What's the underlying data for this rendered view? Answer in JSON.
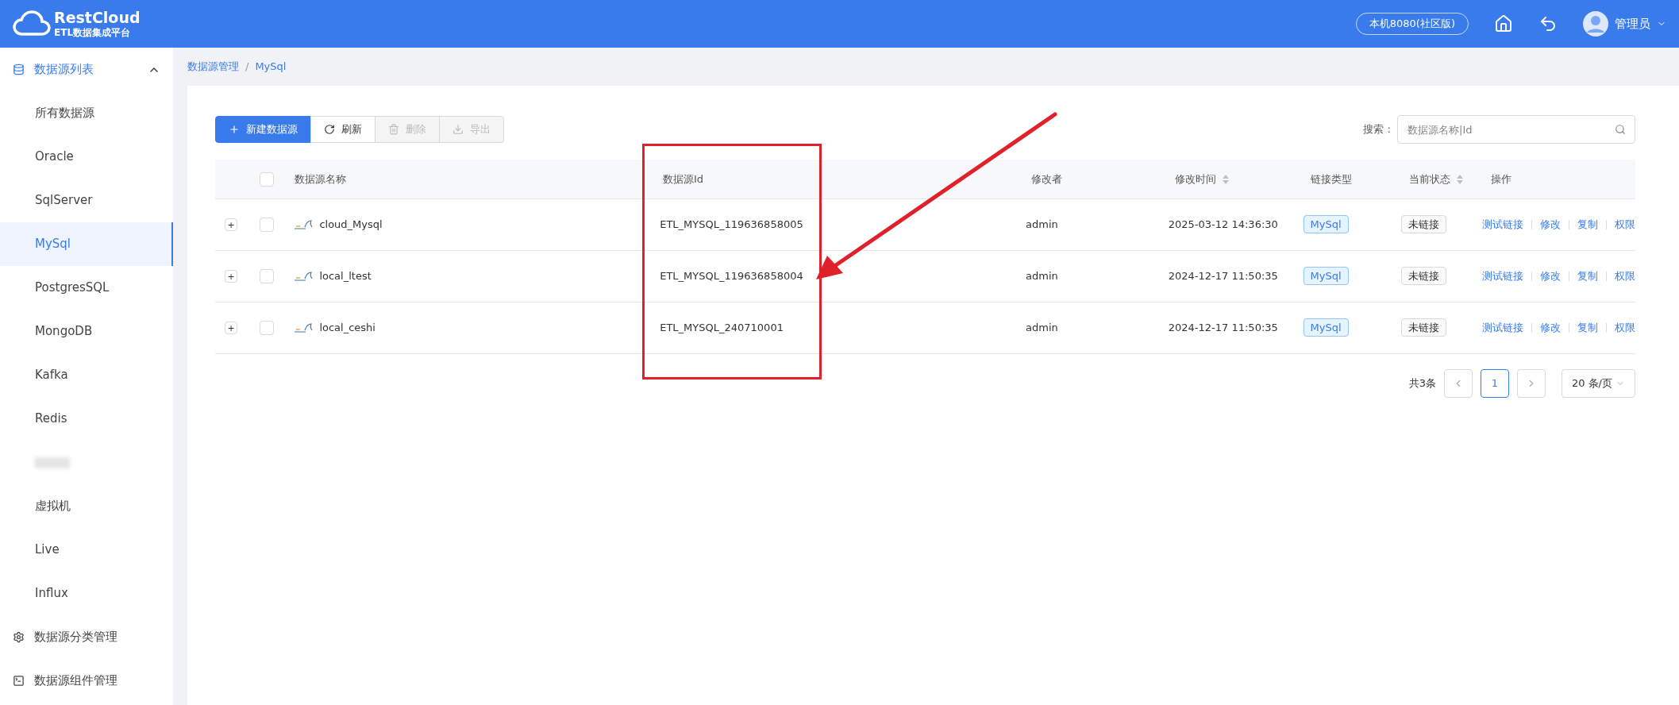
{
  "header": {
    "brand": "RestCloud",
    "subtitle": "ETL数据集成平台",
    "env": "本机8080(社区版)",
    "user": "管理员"
  },
  "sidebar": {
    "group": {
      "label": "数据源列表",
      "expanded": true,
      "items": [
        {
          "kind": "text",
          "label": "所有数据源",
          "selected": false
        },
        {
          "kind": "text",
          "label": "Oracle",
          "selected": false
        },
        {
          "kind": "text",
          "label": "SqlServer",
          "selected": false
        },
        {
          "kind": "text",
          "label": "MySql",
          "selected": true
        },
        {
          "kind": "text",
          "label": "PostgresSQL",
          "selected": false
        },
        {
          "kind": "text",
          "label": "MongoDB",
          "selected": false
        },
        {
          "kind": "text",
          "label": "Kafka",
          "selected": false
        },
        {
          "kind": "text",
          "label": "Redis",
          "selected": false
        },
        {
          "kind": "blurred",
          "selected": false
        },
        {
          "kind": "text",
          "label": "虚拟机",
          "selected": false
        },
        {
          "kind": "text",
          "label": "Live",
          "selected": false
        },
        {
          "kind": "text",
          "label": "Influx",
          "selected": false
        }
      ]
    },
    "links": [
      {
        "kind": "gear",
        "label": "数据源分类管理"
      },
      {
        "kind": "terminal",
        "label": "数据源组件管理"
      }
    ]
  },
  "breadcrumb": {
    "separator": "/",
    "items": [
      "数据源管理",
      "MySql"
    ]
  },
  "toolbar": [
    {
      "kind": "plus",
      "label": "新建数据源",
      "primary": true,
      "disabled": false
    },
    {
      "kind": "refresh",
      "label": "刷新",
      "primary": false,
      "disabled": false
    },
    {
      "kind": "trash",
      "label": "删除",
      "primary": false,
      "disabled": true
    },
    {
      "kind": "download",
      "label": "导出",
      "primary": false,
      "disabled": true
    }
  ],
  "search": {
    "label": "搜索 :",
    "placeholder": "数据源名称|Id"
  },
  "table": {
    "all_checked": false,
    "columns": [
      {
        "label": "数据源名称",
        "sortable": false
      },
      {
        "label": "数据源Id",
        "sortable": false
      },
      {
        "label": "修改者",
        "sortable": false
      },
      {
        "label": "修改时间",
        "sortable": true
      },
      {
        "label": "链接类型",
        "sortable": false
      },
      {
        "label": "当前状态",
        "sortable": true
      },
      {
        "label": "操作",
        "sortable": false
      }
    ],
    "rows": [
      {
        "expand": "+",
        "checked": false,
        "name": "cloud_Mysql",
        "id": "ETL_MYSQL_119636858005",
        "modifier": "admin",
        "time": "2025-03-12 14:36:30",
        "type": "MySql",
        "status": "未链接",
        "actions": [
          "测试链接",
          "修改",
          "复制",
          "权限"
        ]
      },
      {
        "expand": "+",
        "checked": false,
        "name": "local_ltest",
        "id": "ETL_MYSQL_119636858004",
        "modifier": "admin",
        "time": "2024-12-17 11:50:35",
        "type": "MySql",
        "status": "未链接",
        "actions": [
          "测试链接",
          "修改",
          "复制",
          "权限"
        ]
      },
      {
        "expand": "+",
        "checked": false,
        "name": "local_ceshi",
        "id": "ETL_MYSQL_240710001",
        "modifier": "admin",
        "time": "2024-12-17 11:50:35",
        "type": "MySql",
        "status": "未链接",
        "actions": [
          "测试链接",
          "修改",
          "复制",
          "权限"
        ]
      }
    ]
  },
  "pagination": {
    "total": "共3条",
    "pages": [
      {
        "label": "1",
        "selected": true
      }
    ],
    "page_size": "20 条/页"
  }
}
